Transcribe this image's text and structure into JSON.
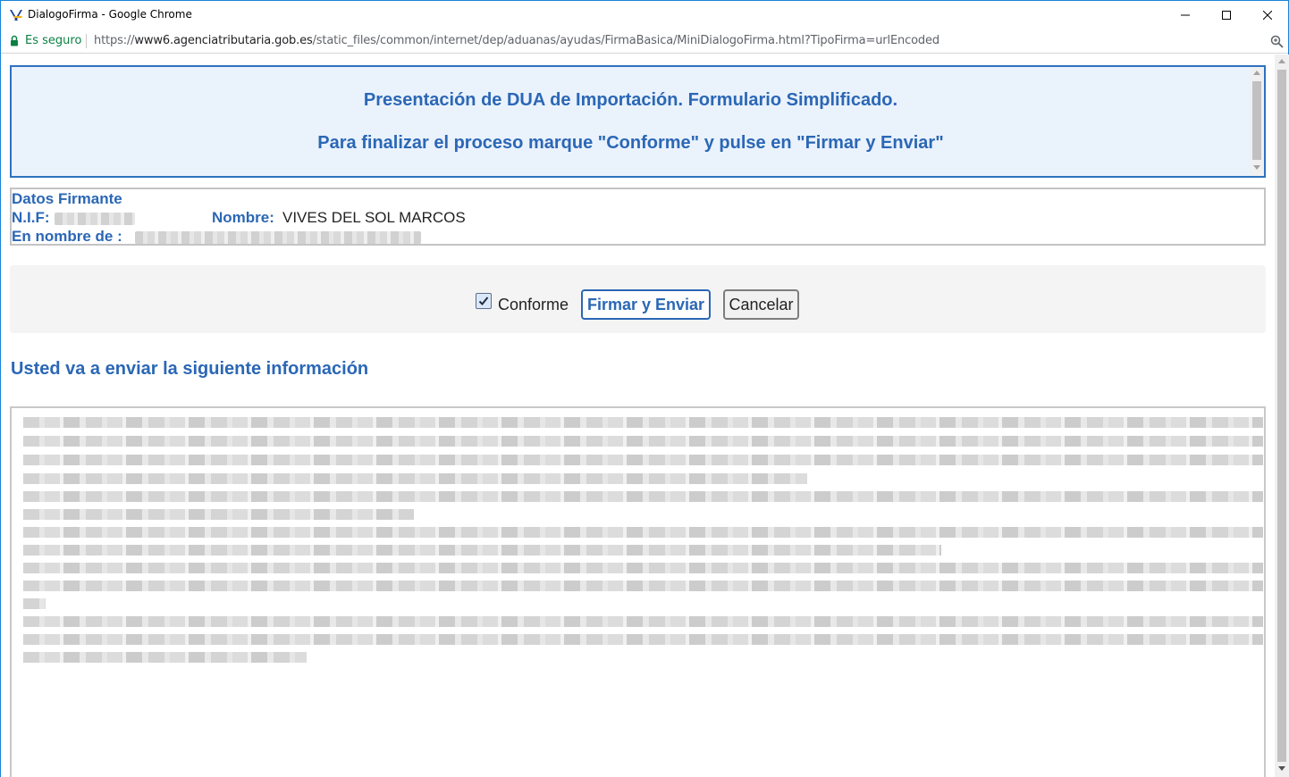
{
  "window": {
    "title": "DialogoFirma - Google Chrome",
    "buttons": [
      "minimize",
      "maximize",
      "close"
    ]
  },
  "address_bar": {
    "security_label": "Es seguro",
    "url_scheme": "https://",
    "url_domain": "www6.agenciatributaria.gob.es",
    "url_path": "/static_files/common/internet/dep/aduanas/ayudas/FirmaBasica/MiniDialogoFirma.html?TipoFirma=urlEncoded"
  },
  "header": {
    "line1": "Presentación de DUA de Importación. Formulario Simplificado.",
    "line2": "Para finalizar el proceso marque \"Conforme\" y pulse en \"Firmar y Enviar\""
  },
  "signer": {
    "section_label": "Datos Firmante",
    "nif_label": "N.I.F:",
    "name_label": "Nombre:",
    "name_value": "VIVES DEL SOL MARCOS",
    "on_behalf_label": "En nombre de :"
  },
  "actions": {
    "conforme_label": "Conforme",
    "conforme_checked": true,
    "sign_button": "Firmar y Enviar",
    "cancel_button": "Cancelar"
  },
  "info": {
    "title": "Usted va a enviar la siguiente información"
  },
  "colors": {
    "accent": "#2b67b5",
    "header_bg": "#eaf2fc",
    "secure_green": "#0b8043"
  }
}
